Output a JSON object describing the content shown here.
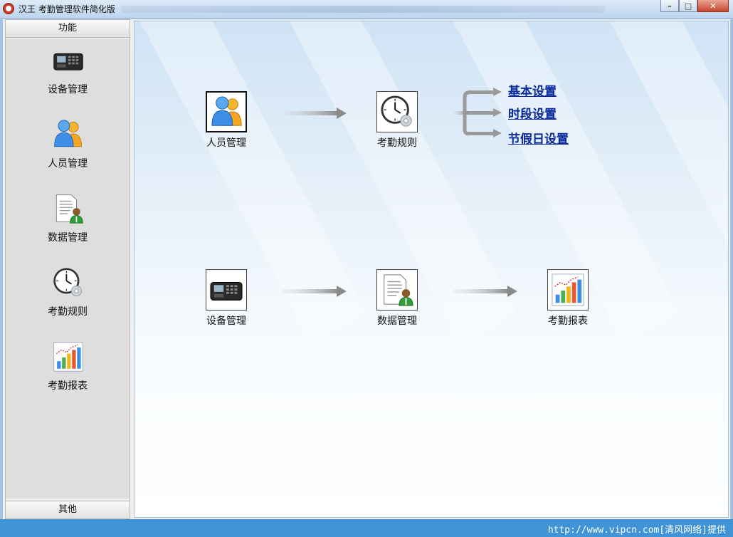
{
  "window": {
    "title": "汉王 考勤管理软件简化版",
    "controls": {
      "minimize": "–",
      "maximize": "□",
      "close": "✕"
    }
  },
  "sidebar": {
    "header": "功能",
    "items": [
      {
        "label": "设备管理",
        "icon": "device-terminal-icon"
      },
      {
        "label": "人员管理",
        "icon": "people-icon"
      },
      {
        "label": "数据管理",
        "icon": "data-document-icon"
      },
      {
        "label": "考勤规则",
        "icon": "clock-icon"
      },
      {
        "label": "考勤报表",
        "icon": "bar-chart-icon"
      }
    ],
    "footer": "其他"
  },
  "flow": {
    "row1": [
      {
        "label": "人员管理",
        "icon": "people-icon"
      },
      {
        "label": "考勤规则",
        "icon": "clock-icon"
      }
    ],
    "rule_links": [
      "基本设置",
      "时段设置",
      "节假日设置"
    ],
    "row2": [
      {
        "label": "设备管理",
        "icon": "device-terminal-icon"
      },
      {
        "label": "数据管理",
        "icon": "data-document-icon"
      },
      {
        "label": "考勤报表",
        "icon": "bar-chart-icon"
      }
    ]
  },
  "status": {
    "text": "http://www.vipcn.com[清风网络]提供"
  },
  "colors": {
    "accent": "#3f93d6",
    "link": "#0a2a9c"
  }
}
